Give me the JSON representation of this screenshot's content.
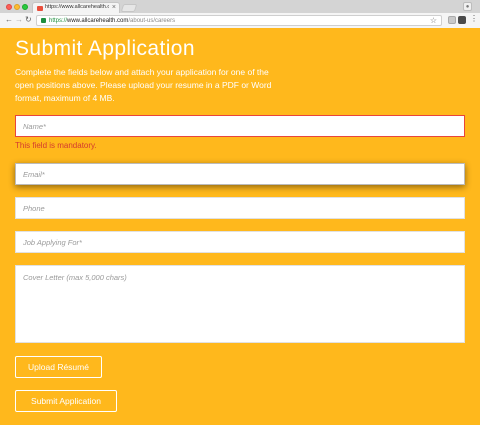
{
  "browser": {
    "tab_title": "https://www.allcarehealth.com/",
    "tab_close": "×",
    "url_scheme": "https://",
    "url_host": "www.allcarehealth.com",
    "url_path": "/about-us/careers",
    "icons": {
      "back": "back-arrow-icon",
      "forward": "forward-arrow-icon",
      "reload": "reload-icon",
      "lock": "lock-icon",
      "bookmark": "star-icon",
      "menu": "kebab-menu-icon"
    }
  },
  "form": {
    "title": "Submit Application",
    "intro": "Complete the fields below and attach your application for one of the open positions above. Please upload your resume in a PDF or Word format, maximum of 4 MB.",
    "fields": {
      "name": {
        "placeholder": "Name*",
        "value": ""
      },
      "name_error": "This field is mandatory.",
      "email": {
        "placeholder": "Email*",
        "value": ""
      },
      "phone": {
        "placeholder": "Phone",
        "value": ""
      },
      "job": {
        "placeholder": "Job Applying For*",
        "value": ""
      },
      "cover_letter": {
        "placeholder": "Cover Letter (max 5,000 chars)",
        "value": ""
      }
    },
    "upload_label": "Upload Résumé",
    "submit_label": "Submit Application"
  },
  "colors": {
    "background": "#ffb81c",
    "error": "#d43a2f",
    "text": "#ffffff"
  }
}
